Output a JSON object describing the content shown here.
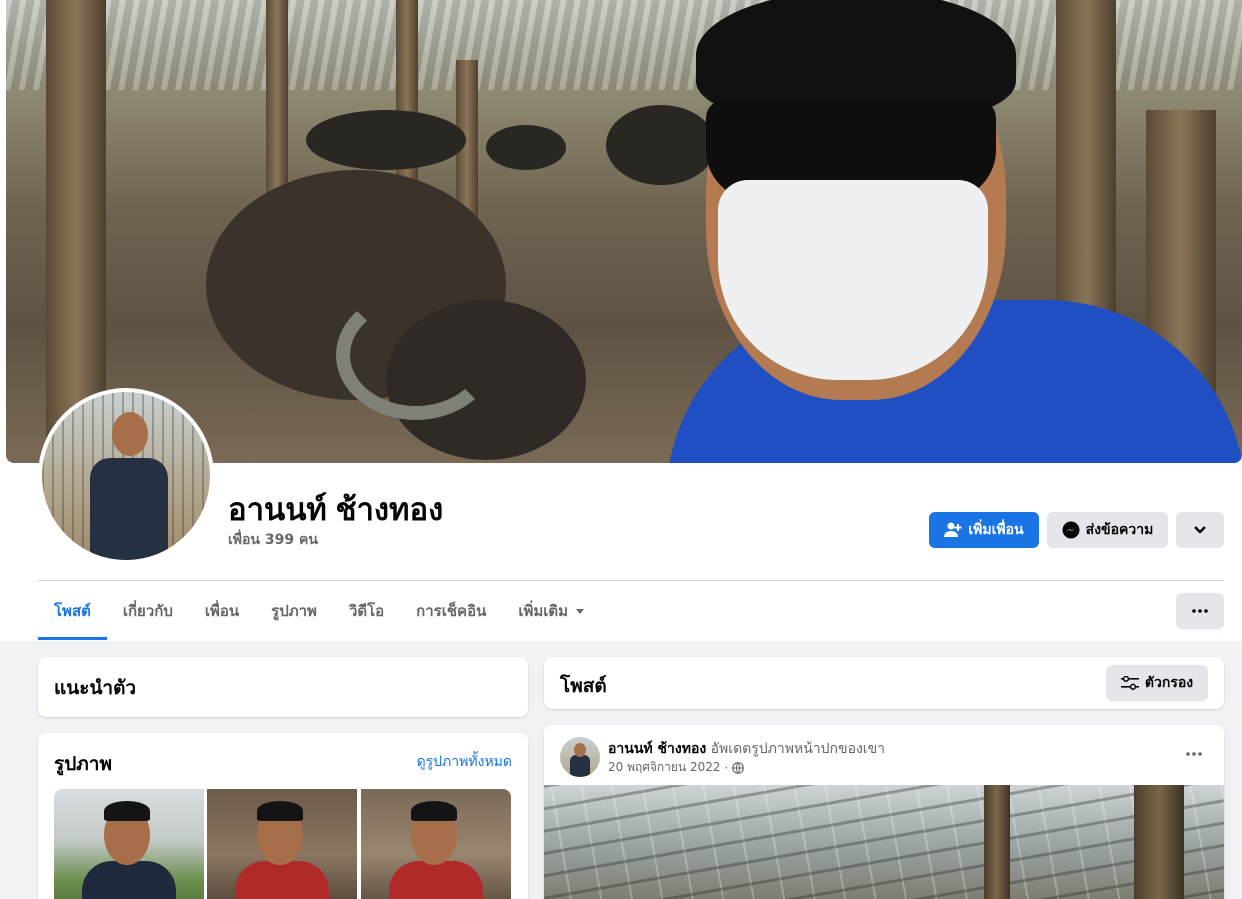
{
  "profile": {
    "name": "อานนท์ ช้างทอง",
    "friends_count_label": "เพื่อน 399 คน"
  },
  "actions": {
    "add_friend_label": "เพิ่มเพื่อน",
    "message_label": "ส่งข้อความ"
  },
  "tabs": [
    {
      "label": "โพสต์",
      "active": true
    },
    {
      "label": "เกี่ยวกับ",
      "active": false
    },
    {
      "label": "เพื่อน",
      "active": false
    },
    {
      "label": "รูปภาพ",
      "active": false
    },
    {
      "label": "วิดีโอ",
      "active": false
    },
    {
      "label": "การเช็คอิน",
      "active": false
    },
    {
      "label": "เพิ่มเติม",
      "active": false
    }
  ],
  "intro": {
    "title": "แนะนำตัว"
  },
  "photos": {
    "title": "รูปภาพ",
    "see_all_label": "ดูรูปภาพทั้งหมด"
  },
  "posts": {
    "title": "โพสต์",
    "filter_label": "ตัวกรอง",
    "items": [
      {
        "author": "อานนท์ ช้างทอง",
        "action": "อัพเดตรูปภาพหน้าปกของเขา",
        "date": "20 พฤศจิกายน 2022",
        "separator": "·",
        "privacy_icon": "globe-icon"
      }
    ]
  },
  "colors": {
    "accent": "#1b74e4",
    "background": "#f0f2f5",
    "secondary_button": "#e4e6eb",
    "secondary_text": "#65676b"
  }
}
